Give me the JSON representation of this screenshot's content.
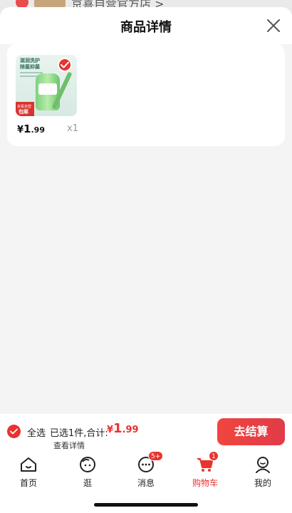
{
  "underlay": {
    "store_title": "京喜自营官方店 >"
  },
  "sheet": {
    "title": "商品详情"
  },
  "product": {
    "image_text1": "滋润洗护",
    "image_text2": "除菌抑菌",
    "promo_text1": "京喜自营",
    "promo_text2": "包邮",
    "price_currency": "¥",
    "price_int": "1",
    "price_dec": ".99",
    "quantity": "x1",
    "selected": true
  },
  "checkout": {
    "select_all_label": "全选",
    "summary_text": "已选1件,合计:",
    "total_currency": "¥",
    "total_int": "1",
    "total_dec": ".99",
    "checkout_label": "去结算",
    "view_detail_label": "查看详情"
  },
  "tabs": [
    {
      "label": "首页",
      "icon": "home-icon"
    },
    {
      "label": "逛",
      "icon": "face-icon"
    },
    {
      "label": "消息",
      "icon": "message-icon",
      "badge": "5+"
    },
    {
      "label": "购物车",
      "icon": "cart-icon",
      "badge": "1",
      "active": true
    },
    {
      "label": "我的",
      "icon": "profile-icon"
    }
  ],
  "colors": {
    "accent": "#e8332f"
  }
}
